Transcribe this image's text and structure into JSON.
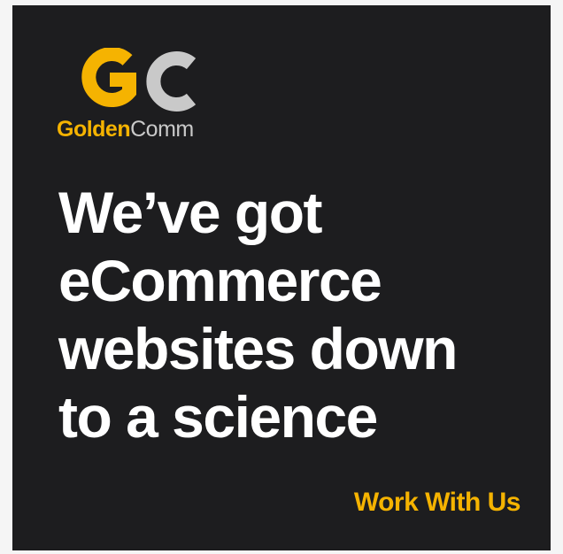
{
  "brand": {
    "name_part1": "Golden",
    "name_part2": "Comm",
    "monogram": "GC",
    "colors": {
      "gold": "#f5b301",
      "gray": "#c9c9c9",
      "background": "#1d1d1f",
      "text": "#ffffff"
    }
  },
  "headline": {
    "lines": [
      "We’ve got",
      "eCommerce",
      "websites down",
      "to a science"
    ]
  },
  "cta": {
    "label": "Work With Us"
  }
}
